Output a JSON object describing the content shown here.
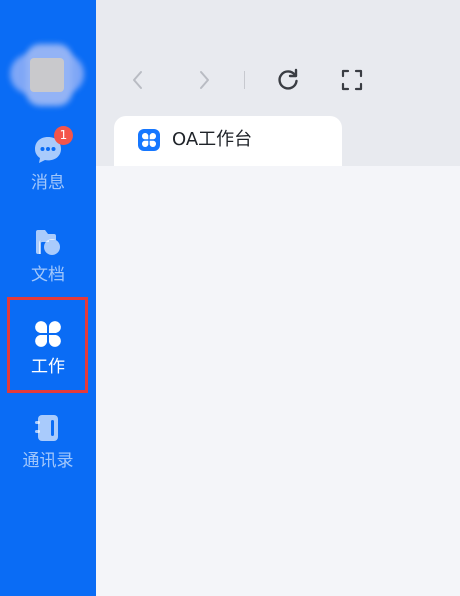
{
  "sidebar": {
    "colors": {
      "background": "#0a6cf5",
      "badge": "#f4554a",
      "highlight": "#e33a3a"
    },
    "items": [
      {
        "label": "消息",
        "icon": "message-bubble-icon",
        "badge": "1"
      },
      {
        "label": "文档",
        "icon": "folder-doc-icon"
      },
      {
        "label": "工作",
        "icon": "workspace-clover-icon",
        "active": true
      },
      {
        "label": "通讯录",
        "icon": "contacts-book-icon"
      }
    ]
  },
  "toolbar": {
    "buttons": [
      {
        "name": "back",
        "icon": "chevron-left-icon"
      },
      {
        "name": "forward",
        "icon": "chevron-right-icon"
      },
      {
        "name": "refresh",
        "icon": "refresh-icon"
      },
      {
        "name": "fullscreen",
        "icon": "fullscreen-icon"
      }
    ]
  },
  "tabs": [
    {
      "label": "OA工作台",
      "icon": "app-clover-icon",
      "active": true
    }
  ]
}
